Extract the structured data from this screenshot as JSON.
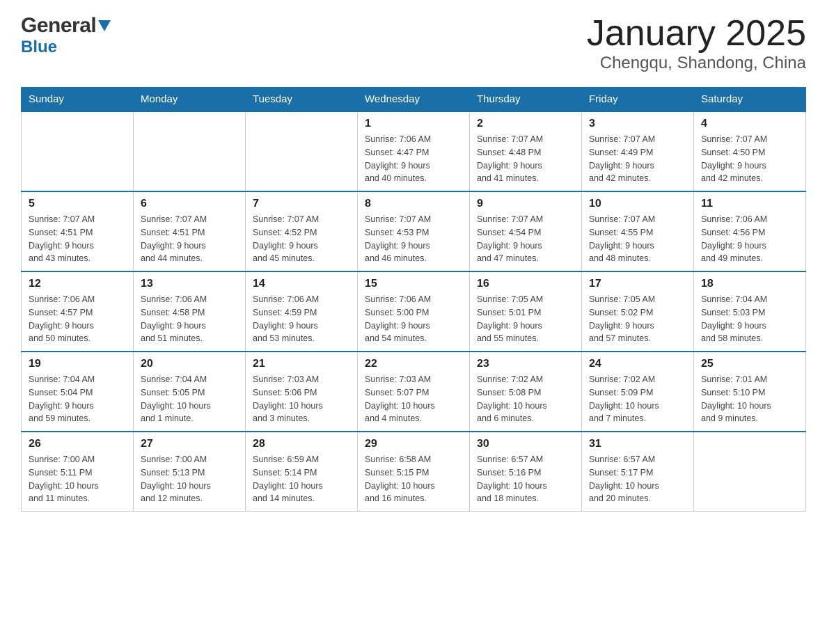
{
  "header": {
    "logo": {
      "general": "General",
      "blue": "Blue",
      "arrow_unicode": "▼"
    },
    "title": "January 2025",
    "subtitle": "Chengqu, Shandong, China"
  },
  "calendar": {
    "days_of_week": [
      "Sunday",
      "Monday",
      "Tuesday",
      "Wednesday",
      "Thursday",
      "Friday",
      "Saturday"
    ],
    "weeks": [
      [
        {
          "day": "",
          "info": ""
        },
        {
          "day": "",
          "info": ""
        },
        {
          "day": "",
          "info": ""
        },
        {
          "day": "1",
          "info": "Sunrise: 7:06 AM\nSunset: 4:47 PM\nDaylight: 9 hours\nand 40 minutes."
        },
        {
          "day": "2",
          "info": "Sunrise: 7:07 AM\nSunset: 4:48 PM\nDaylight: 9 hours\nand 41 minutes."
        },
        {
          "day": "3",
          "info": "Sunrise: 7:07 AM\nSunset: 4:49 PM\nDaylight: 9 hours\nand 42 minutes."
        },
        {
          "day": "4",
          "info": "Sunrise: 7:07 AM\nSunset: 4:50 PM\nDaylight: 9 hours\nand 42 minutes."
        }
      ],
      [
        {
          "day": "5",
          "info": "Sunrise: 7:07 AM\nSunset: 4:51 PM\nDaylight: 9 hours\nand 43 minutes."
        },
        {
          "day": "6",
          "info": "Sunrise: 7:07 AM\nSunset: 4:51 PM\nDaylight: 9 hours\nand 44 minutes."
        },
        {
          "day": "7",
          "info": "Sunrise: 7:07 AM\nSunset: 4:52 PM\nDaylight: 9 hours\nand 45 minutes."
        },
        {
          "day": "8",
          "info": "Sunrise: 7:07 AM\nSunset: 4:53 PM\nDaylight: 9 hours\nand 46 minutes."
        },
        {
          "day": "9",
          "info": "Sunrise: 7:07 AM\nSunset: 4:54 PM\nDaylight: 9 hours\nand 47 minutes."
        },
        {
          "day": "10",
          "info": "Sunrise: 7:07 AM\nSunset: 4:55 PM\nDaylight: 9 hours\nand 48 minutes."
        },
        {
          "day": "11",
          "info": "Sunrise: 7:06 AM\nSunset: 4:56 PM\nDaylight: 9 hours\nand 49 minutes."
        }
      ],
      [
        {
          "day": "12",
          "info": "Sunrise: 7:06 AM\nSunset: 4:57 PM\nDaylight: 9 hours\nand 50 minutes."
        },
        {
          "day": "13",
          "info": "Sunrise: 7:06 AM\nSunset: 4:58 PM\nDaylight: 9 hours\nand 51 minutes."
        },
        {
          "day": "14",
          "info": "Sunrise: 7:06 AM\nSunset: 4:59 PM\nDaylight: 9 hours\nand 53 minutes."
        },
        {
          "day": "15",
          "info": "Sunrise: 7:06 AM\nSunset: 5:00 PM\nDaylight: 9 hours\nand 54 minutes."
        },
        {
          "day": "16",
          "info": "Sunrise: 7:05 AM\nSunset: 5:01 PM\nDaylight: 9 hours\nand 55 minutes."
        },
        {
          "day": "17",
          "info": "Sunrise: 7:05 AM\nSunset: 5:02 PM\nDaylight: 9 hours\nand 57 minutes."
        },
        {
          "day": "18",
          "info": "Sunrise: 7:04 AM\nSunset: 5:03 PM\nDaylight: 9 hours\nand 58 minutes."
        }
      ],
      [
        {
          "day": "19",
          "info": "Sunrise: 7:04 AM\nSunset: 5:04 PM\nDaylight: 9 hours\nand 59 minutes."
        },
        {
          "day": "20",
          "info": "Sunrise: 7:04 AM\nSunset: 5:05 PM\nDaylight: 10 hours\nand 1 minute."
        },
        {
          "day": "21",
          "info": "Sunrise: 7:03 AM\nSunset: 5:06 PM\nDaylight: 10 hours\nand 3 minutes."
        },
        {
          "day": "22",
          "info": "Sunrise: 7:03 AM\nSunset: 5:07 PM\nDaylight: 10 hours\nand 4 minutes."
        },
        {
          "day": "23",
          "info": "Sunrise: 7:02 AM\nSunset: 5:08 PM\nDaylight: 10 hours\nand 6 minutes."
        },
        {
          "day": "24",
          "info": "Sunrise: 7:02 AM\nSunset: 5:09 PM\nDaylight: 10 hours\nand 7 minutes."
        },
        {
          "day": "25",
          "info": "Sunrise: 7:01 AM\nSunset: 5:10 PM\nDaylight: 10 hours\nand 9 minutes."
        }
      ],
      [
        {
          "day": "26",
          "info": "Sunrise: 7:00 AM\nSunset: 5:11 PM\nDaylight: 10 hours\nand 11 minutes."
        },
        {
          "day": "27",
          "info": "Sunrise: 7:00 AM\nSunset: 5:13 PM\nDaylight: 10 hours\nand 12 minutes."
        },
        {
          "day": "28",
          "info": "Sunrise: 6:59 AM\nSunset: 5:14 PM\nDaylight: 10 hours\nand 14 minutes."
        },
        {
          "day": "29",
          "info": "Sunrise: 6:58 AM\nSunset: 5:15 PM\nDaylight: 10 hours\nand 16 minutes."
        },
        {
          "day": "30",
          "info": "Sunrise: 6:57 AM\nSunset: 5:16 PM\nDaylight: 10 hours\nand 18 minutes."
        },
        {
          "day": "31",
          "info": "Sunrise: 6:57 AM\nSunset: 5:17 PM\nDaylight: 10 hours\nand 20 minutes."
        },
        {
          "day": "",
          "info": ""
        }
      ]
    ]
  }
}
